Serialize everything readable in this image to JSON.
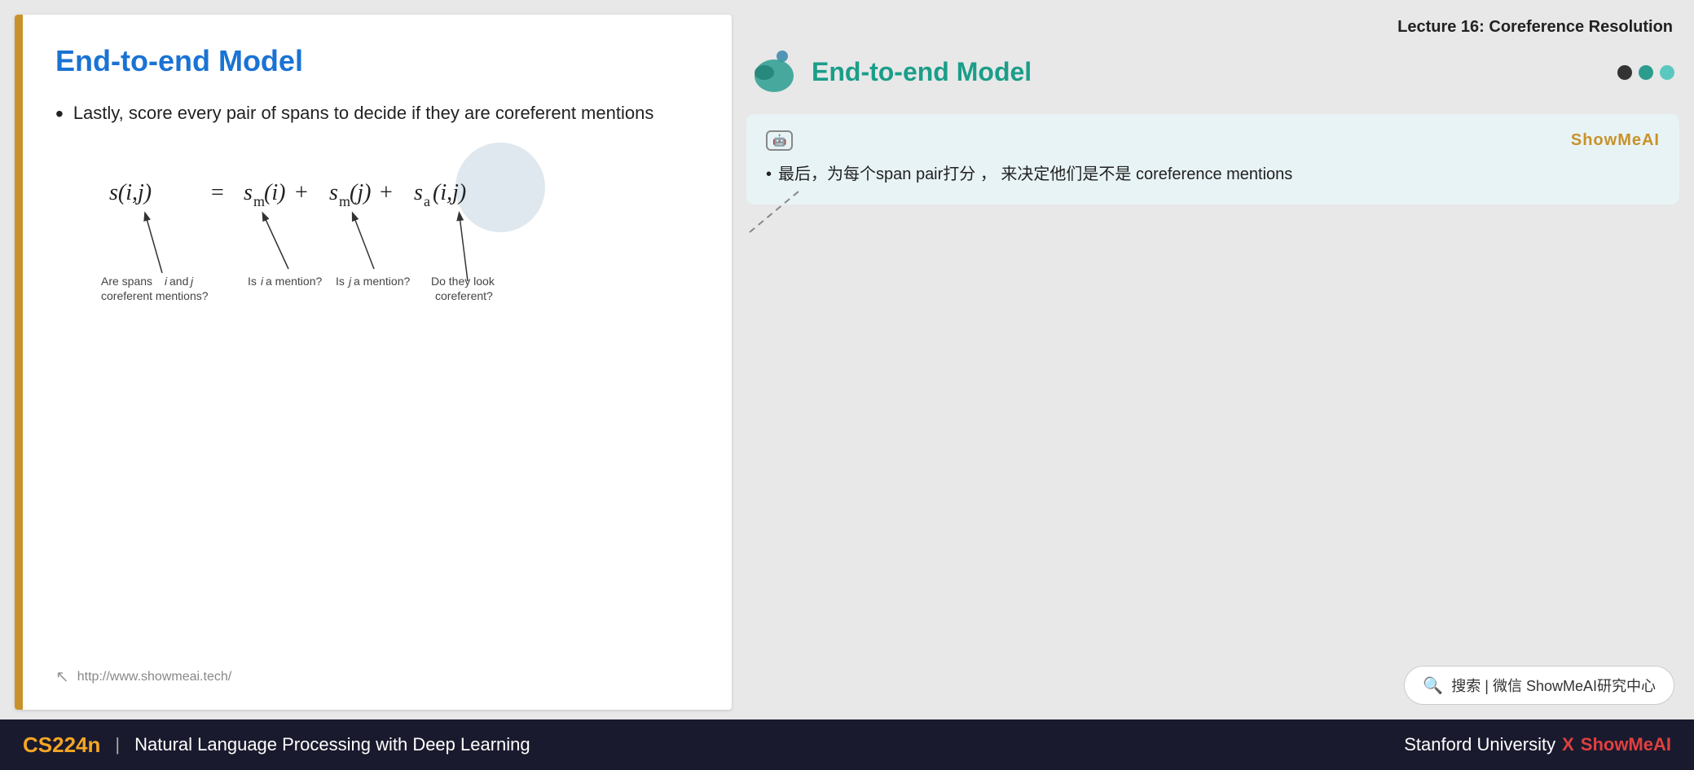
{
  "lecture_title": "Lecture 16: Coreference Resolution",
  "slide": {
    "title": "End-to-end Model",
    "bullet": "Lastly, score every pair of spans to decide if they are coreferent mentions",
    "formula_labels": {
      "left": "Are spans i and j coreferent mentions?",
      "center_left": "Is i a mention?",
      "center_right": "Is j a mention?",
      "right": "Do they look coreferent?"
    },
    "footer_url": "http://www.showmeai.tech/"
  },
  "right_panel": {
    "title": "End-to-end Model",
    "annotation": {
      "ai_icon": "AI",
      "showmeai_label": "ShowMeAI",
      "content": "最后，为每个span   pair打分  ，  来决定他们是不是 coreference mentions"
    }
  },
  "search_box": {
    "placeholder": "搜索 | 微信 ShowMeAI研究中心"
  },
  "bottom_bar": {
    "course_code": "CS224n",
    "separator": "|",
    "course_name": "Natural Language Processing with Deep Learning",
    "university": "Stanford University",
    "x_mark": "X",
    "brand": "ShowMeAI"
  },
  "dots": [
    {
      "color": "dark"
    },
    {
      "color": "teal"
    },
    {
      "color": "light-teal"
    }
  ]
}
